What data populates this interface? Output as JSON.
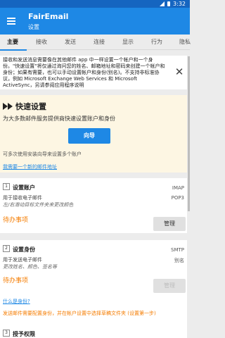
{
  "statusbar": {
    "time": "3:32"
  },
  "appbar": {
    "title": "FairEmail",
    "subtitle": "设置"
  },
  "tabs": [
    "主要",
    "接收",
    "发送",
    "连接",
    "显示",
    "行为",
    "隐私"
  ],
  "info": {
    "text": "接收和发送消息需要像在其他邮件 app 中一样设置一个帐户和一个身份。\"快速设置\"将仅通过询问您的姓名、邮箱地址和密码来创建一个帐户和身份；如果有需要，也可以手动设置帐户和身份(别名)。不支持非标准协议，例如 Microsoft Exchange Web Services 和 Microsoft ActiveSync，另请参阅应用程序说明",
    "close_label": "✕"
  },
  "quick_setup": {
    "title": "快速设置",
    "description": "为大多数邮件服务提供商快速设置账户和身份",
    "wizard_button": "向导",
    "note": "可多次使用安装向导来设置多个账户",
    "link": "我需要一个新的邮件地址"
  },
  "step1": {
    "num": "1",
    "title": "设置账户",
    "line1": "用于接收电子邮件",
    "line2": "左/右滑动目标文件夹来更改颜色",
    "right1": "IMAP",
    "right2": "POP3",
    "todo": "待办事项",
    "button": "管理"
  },
  "step2": {
    "num": "2",
    "title": "设置身份",
    "line1": "用于发送电子邮件",
    "line2": "更改姓名、颜色、签名等",
    "right1": "SMTP",
    "right2": "别名",
    "todo": "待办事项",
    "button": "管理",
    "link": "什么是身份?",
    "warning": "发送邮件需要配置身份，并在帐户设置中选择草稿文件夹 (设置第一步)"
  },
  "step3": {
    "num": "3",
    "title": "授予权限"
  }
}
